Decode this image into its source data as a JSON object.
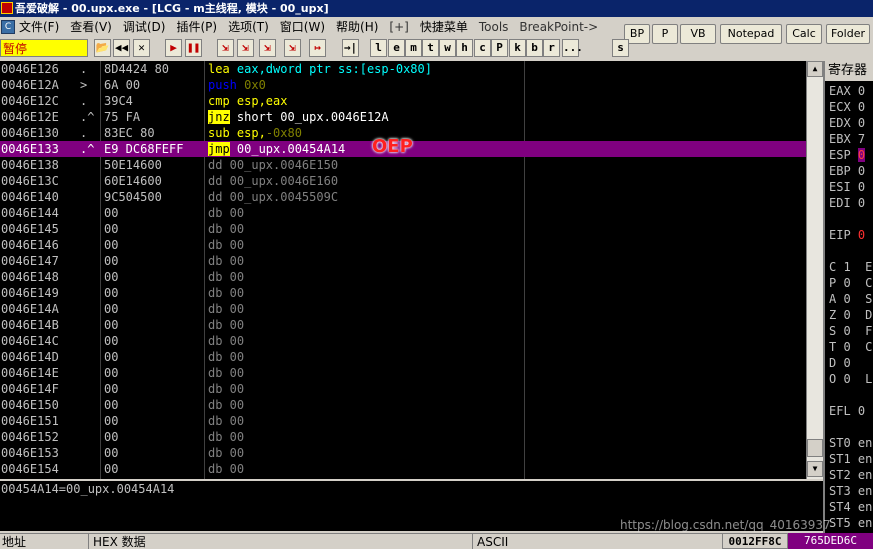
{
  "window": {
    "title": "吾爱破解 - 00.upx.exe - [LCG - m主线程, 模块 - 00_upx]"
  },
  "menu": {
    "cpu_icon": "cpu-icon",
    "items": [
      "文件(F)",
      "查看(V)",
      "调试(D)",
      "插件(P)",
      "选项(T)",
      "窗口(W)",
      "帮助(H)",
      "[+]",
      "快捷菜单",
      "Tools",
      "BreakPoint->"
    ]
  },
  "right_buttons": [
    "BP",
    "P",
    "VB",
    "Notepad",
    "Calc",
    "Folder"
  ],
  "toolbar": {
    "status": "暂停",
    "buttons": [
      "📂",
      "◀◀",
      "✕",
      "▶",
      "❚❚",
      "⇲",
      "⇲",
      "⇲",
      "⇲",
      "↦",
      "→|",
      "l",
      "e",
      "m",
      "t",
      "w",
      "h",
      "c",
      "P",
      "k",
      "b",
      "r",
      "...",
      "s"
    ]
  },
  "disasm": {
    "rows": [
      {
        "addr": "0046E126",
        "mark": ".",
        "hex": "8D4424 80",
        "asm": [
          [
            "lea",
            "kw"
          ],
          [
            " eax,dword ptr ss:[esp-0x80]",
            "ptr"
          ]
        ]
      },
      {
        "addr": "0046E12A",
        "mark": ">",
        "hex": "6A 00",
        "asm": [
          [
            "push",
            "push"
          ],
          [
            " 0x0",
            "imm"
          ]
        ]
      },
      {
        "addr": "0046E12C",
        "mark": ".",
        "hex": "39C4",
        "asm": [
          [
            "cmp",
            "kw"
          ],
          [
            " esp,eax",
            "reg"
          ]
        ]
      },
      {
        "addr": "0046E12E",
        "mark": ".^",
        "hex": "75 FA",
        "asm": [
          [
            "jnz",
            "jmp"
          ],
          [
            " short 00_upx.0046E12A",
            "op"
          ]
        ]
      },
      {
        "addr": "0046E130",
        "mark": ".",
        "hex": "83EC 80",
        "asm": [
          [
            "sub",
            "kw"
          ],
          [
            " esp,",
            "reg"
          ],
          [
            "-0x80",
            "imm"
          ]
        ]
      },
      {
        "addr": "0046E133",
        "mark": ".^",
        "hex": "E9 DC68FEFF",
        "asm": [
          [
            "jmp",
            "jmp"
          ],
          [
            " 00_upx.00454A14",
            "op"
          ]
        ],
        "selected": true
      },
      {
        "addr": "0046E138",
        "mark": "",
        "hex": "50E14600",
        "asm": [
          [
            "dd 00_upx.0046E150",
            "db"
          ]
        ]
      },
      {
        "addr": "0046E13C",
        "mark": "",
        "hex": "60E14600",
        "asm": [
          [
            "dd 00_upx.0046E160",
            "db"
          ]
        ]
      },
      {
        "addr": "0046E140",
        "mark": "",
        "hex": "9C504500",
        "asm": [
          [
            "dd 00_upx.0045509C",
            "db"
          ]
        ]
      },
      {
        "addr": "0046E144",
        "mark": "",
        "hex": "00",
        "asm": [
          [
            "db 00",
            "db"
          ]
        ]
      },
      {
        "addr": "0046E145",
        "mark": "",
        "hex": "00",
        "asm": [
          [
            "db 00",
            "db"
          ]
        ]
      },
      {
        "addr": "0046E146",
        "mark": "",
        "hex": "00",
        "asm": [
          [
            "db 00",
            "db"
          ]
        ]
      },
      {
        "addr": "0046E147",
        "mark": "",
        "hex": "00",
        "asm": [
          [
            "db 00",
            "db"
          ]
        ]
      },
      {
        "addr": "0046E148",
        "mark": "",
        "hex": "00",
        "asm": [
          [
            "db 00",
            "db"
          ]
        ]
      },
      {
        "addr": "0046E149",
        "mark": "",
        "hex": "00",
        "asm": [
          [
            "db 00",
            "db"
          ]
        ]
      },
      {
        "addr": "0046E14A",
        "mark": "",
        "hex": "00",
        "asm": [
          [
            "db 00",
            "db"
          ]
        ]
      },
      {
        "addr": "0046E14B",
        "mark": "",
        "hex": "00",
        "asm": [
          [
            "db 00",
            "db"
          ]
        ]
      },
      {
        "addr": "0046E14C",
        "mark": "",
        "hex": "00",
        "asm": [
          [
            "db 00",
            "db"
          ]
        ]
      },
      {
        "addr": "0046E14D",
        "mark": "",
        "hex": "00",
        "asm": [
          [
            "db 00",
            "db"
          ]
        ]
      },
      {
        "addr": "0046E14E",
        "mark": "",
        "hex": "00",
        "asm": [
          [
            "db 00",
            "db"
          ]
        ]
      },
      {
        "addr": "0046E14F",
        "mark": "",
        "hex": "00",
        "asm": [
          [
            "db 00",
            "db"
          ]
        ]
      },
      {
        "addr": "0046E150",
        "mark": "",
        "hex": "00",
        "asm": [
          [
            "db 00",
            "db"
          ]
        ]
      },
      {
        "addr": "0046E151",
        "mark": "",
        "hex": "00",
        "asm": [
          [
            "db 00",
            "db"
          ]
        ]
      },
      {
        "addr": "0046E152",
        "mark": "",
        "hex": "00",
        "asm": [
          [
            "db 00",
            "db"
          ]
        ]
      },
      {
        "addr": "0046E153",
        "mark": "",
        "hex": "00",
        "asm": [
          [
            "db 00",
            "db"
          ]
        ]
      },
      {
        "addr": "0046E154",
        "mark": "",
        "hex": "00",
        "asm": [
          [
            "db 00",
            "db"
          ]
        ]
      }
    ],
    "annotation": "OEP"
  },
  "info_line": "00454A14=00_upx.00454A14",
  "dump_header": {
    "address": "地址",
    "hex": "HEX 数据",
    "ascii": "ASCII"
  },
  "stack": {
    "address": "0012FF8C",
    "value": "765DED6C"
  },
  "registers": {
    "header": "寄存器",
    "lines": [
      {
        "text": "EAX 0"
      },
      {
        "text": "ECX 0"
      },
      {
        "text": "EDX 0"
      },
      {
        "text": "EBX 7"
      },
      {
        "text": "ESP ",
        "hl": "0"
      },
      {
        "text": "EBP 0"
      },
      {
        "text": "ESI 0"
      },
      {
        "text": "EDI 0"
      },
      {
        "text": ""
      },
      {
        "text": "EIP ",
        "red": "0"
      },
      {
        "text": ""
      },
      {
        "text": "C 1  E"
      },
      {
        "text": "P 0  C"
      },
      {
        "text": "A 0  S"
      },
      {
        "text": "Z 0  D"
      },
      {
        "text": "S 0  F"
      },
      {
        "text": "T 0  C"
      },
      {
        "text": "D 0"
      },
      {
        "text": "O 0  L"
      },
      {
        "text": ""
      },
      {
        "text": "EFL 0"
      },
      {
        "text": ""
      },
      {
        "text": "ST0 en"
      },
      {
        "text": "ST1 en"
      },
      {
        "text": "ST2 en"
      },
      {
        "text": "ST3 en"
      },
      {
        "text": "ST4 en"
      },
      {
        "text": "ST5 en"
      },
      {
        "text": "ST6 en"
      },
      {
        "text": "ST7 en"
      }
    ]
  },
  "watermark": "https://blog.csdn.net/qq_40163937"
}
